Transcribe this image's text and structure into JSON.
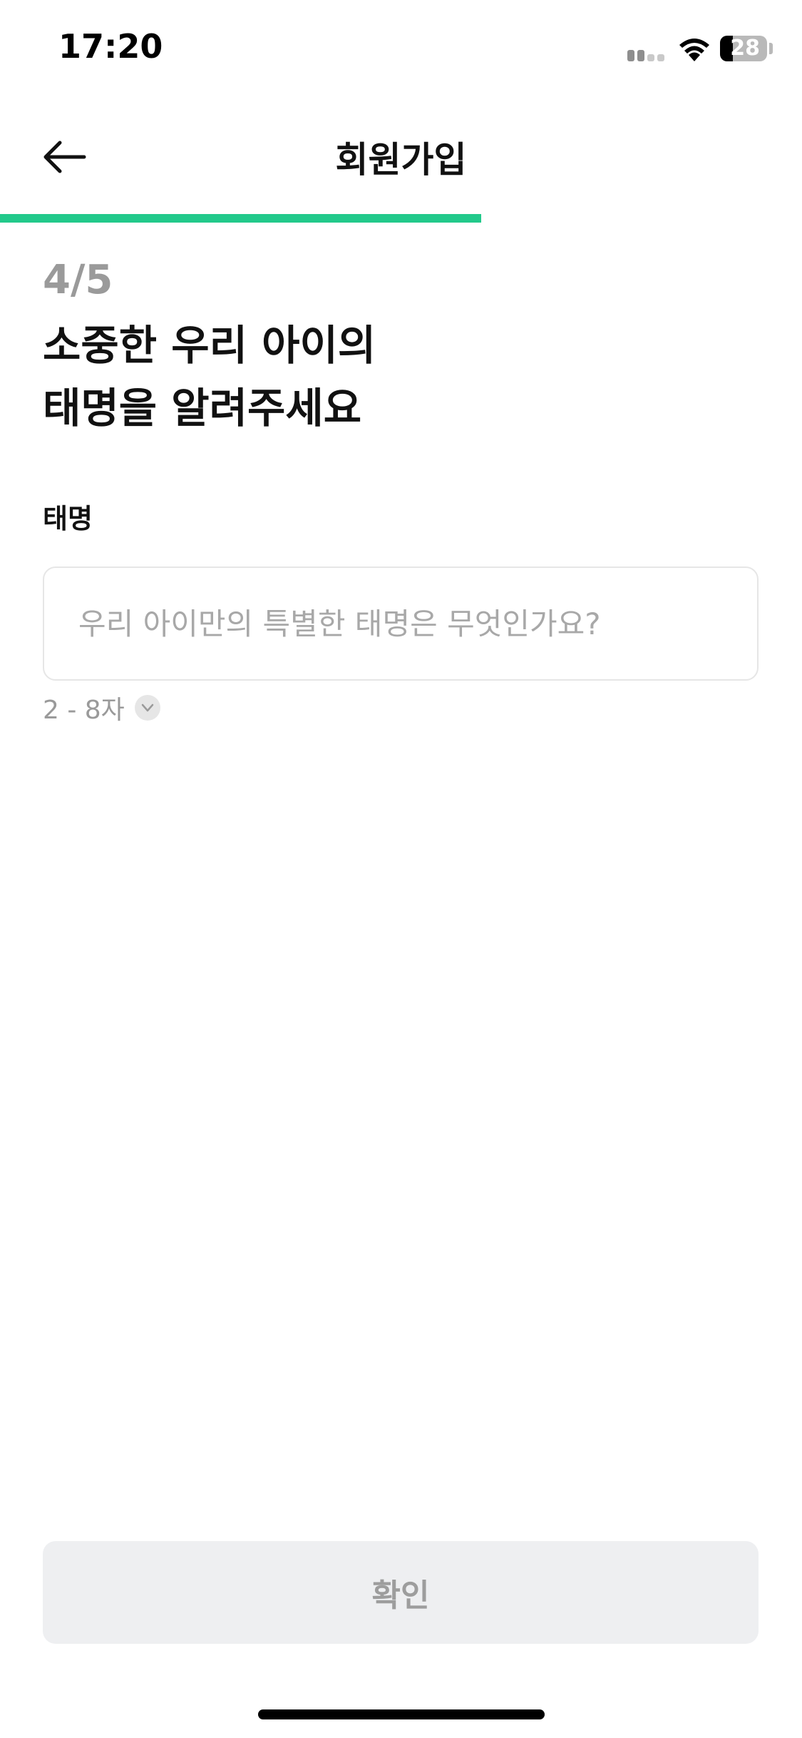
{
  "status_bar": {
    "time": "17:20",
    "battery_level": "28",
    "battery_fraction": 0.28
  },
  "nav": {
    "title": "회원가입",
    "back_icon": "arrow-left-icon"
  },
  "progress": {
    "fraction": 0.6,
    "color": "#22c98b"
  },
  "step": {
    "count": "4/5",
    "heading_line1": "소중한 우리 아이의",
    "heading_line2": "태명을 알려주세요"
  },
  "form": {
    "label": "태명",
    "value": "",
    "placeholder": "우리 아이만의 특별한 태명은 무엇인가요?",
    "hint": "2 - 8자",
    "hint_icon": "check-circle-icon"
  },
  "confirm_button": {
    "label": "확인"
  }
}
